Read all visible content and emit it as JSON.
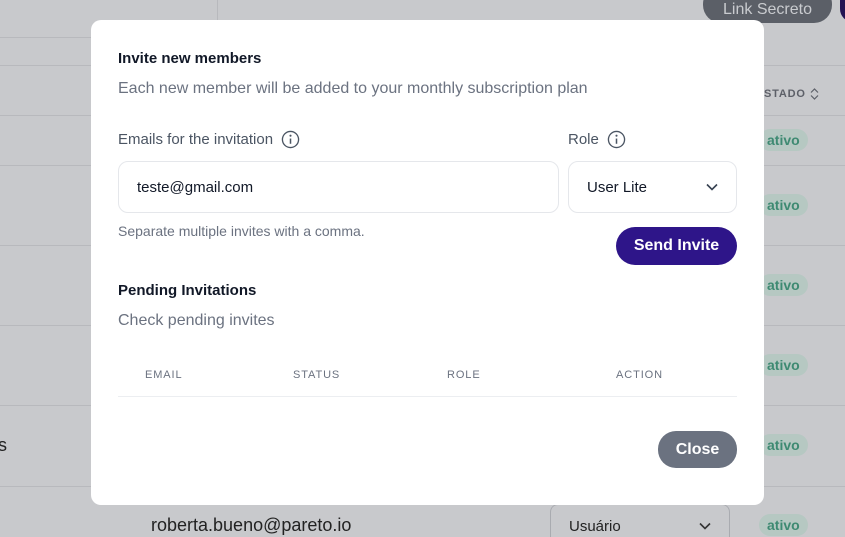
{
  "background": {
    "link_button_label": "Link Secreto",
    "column_header": "STADO",
    "status_badge": "ativo",
    "row_text_fragment": "s",
    "row_email": "roberta.bueno@pareto.io",
    "row_role_select": "Usuário"
  },
  "modal": {
    "title": "Invite new members",
    "subtitle": "Each new member will be added to your monthly subscription plan",
    "emails_label": "Emails for the invitation",
    "emails_value": "teste@gmail.com",
    "role_label": "Role",
    "role_value": "User Lite",
    "hint": "Separate multiple invites with a comma.",
    "send_button": "Send Invite",
    "pending_title": "Pending Invitations",
    "pending_subtitle": "Check pending invites",
    "table_headers": [
      "EMAIL",
      "STATUS",
      "ROLE",
      "ACTION"
    ],
    "close_button": "Close"
  },
  "colors": {
    "primary": "#2e1589",
    "close_button": "#6b7280",
    "overlay": "#c8c9cc"
  }
}
